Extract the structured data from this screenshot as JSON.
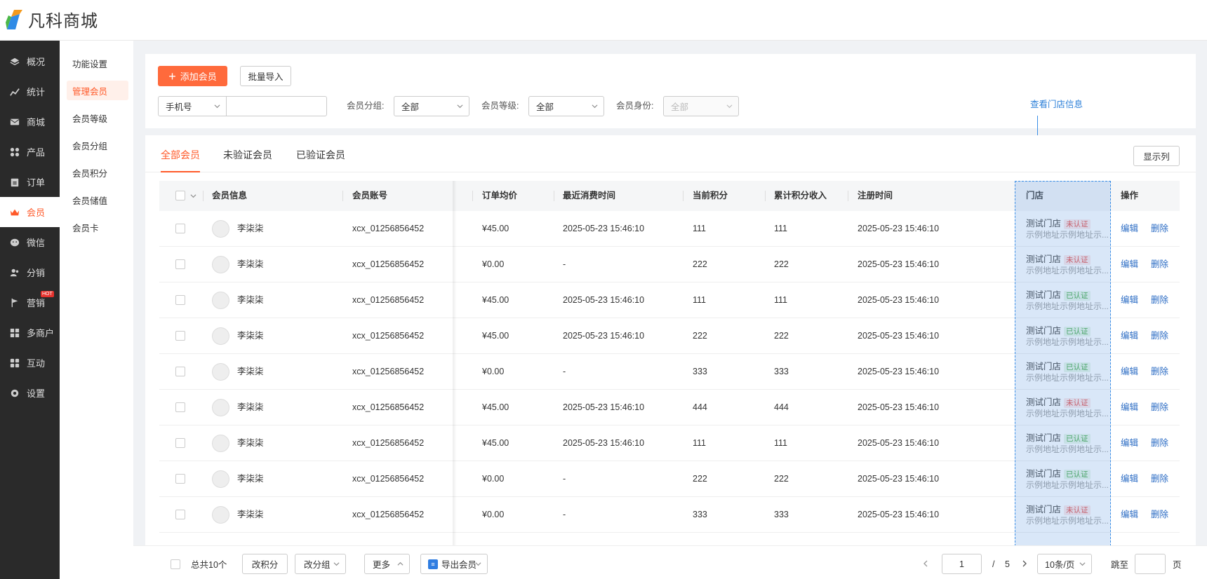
{
  "brand": {
    "name": "凡科商城"
  },
  "nav_main": [
    {
      "label": "概况",
      "icon": "layers-icon"
    },
    {
      "label": "统计",
      "icon": "chart-icon"
    },
    {
      "label": "商城",
      "icon": "mail-icon"
    },
    {
      "label": "产品",
      "icon": "grid-icon"
    },
    {
      "label": "订单",
      "icon": "clipboard-icon"
    },
    {
      "label": "会员",
      "icon": "crown-icon",
      "active": true
    },
    {
      "label": "微信",
      "icon": "wechat-icon"
    },
    {
      "label": "分销",
      "icon": "users-icon"
    },
    {
      "label": "营销",
      "icon": "flag-icon",
      "badge": "HOT"
    },
    {
      "label": "多商户",
      "icon": "store-icon"
    },
    {
      "label": "互动",
      "icon": "apps-icon"
    },
    {
      "label": "设置",
      "icon": "gear-icon"
    }
  ],
  "nav_sub": [
    {
      "label": "功能设置"
    },
    {
      "label": "管理会员",
      "active": true
    },
    {
      "label": "会员等级"
    },
    {
      "label": "会员分组"
    },
    {
      "label": "会员积分"
    },
    {
      "label": "会员储值"
    },
    {
      "label": "会员卡"
    }
  ],
  "toolbar": {
    "add_label": "添加会员",
    "import_label": "批量导入"
  },
  "filters": {
    "search_field": "手机号",
    "search_value": "",
    "group_label": "会员分组:",
    "group_value": "全部",
    "level_label": "会员等级:",
    "level_value": "全部",
    "identity_label": "会员身份:",
    "identity_placeholder": "全部"
  },
  "annotation": {
    "tip": "查看门店信息"
  },
  "tabs": [
    {
      "label": "全部会员",
      "active": true
    },
    {
      "label": "未验证会员"
    },
    {
      "label": "已验证会员"
    }
  ],
  "columns_button": "显示列",
  "table": {
    "headers": {
      "info": "会员信息",
      "account": "会员账号",
      "avg": "订单均价",
      "last": "最近消费时间",
      "points": "当前积分",
      "total": "累计积分收入",
      "reg": "注册时间",
      "store": "门店",
      "ops": "操作"
    },
    "rows": [
      {
        "name": "李柒柒",
        "account": "xcx_01256856452",
        "avg": "¥45.00",
        "last": "2025-05-23 15:46:10",
        "points": "111",
        "total": "111",
        "reg": "2025-05-23 15:46:10",
        "store": "测试门店",
        "status": "未认证",
        "verified": false,
        "addr": "示例地址示例地址示..."
      },
      {
        "name": "李柒柒",
        "account": "xcx_01256856452",
        "avg": "¥0.00",
        "last": "-",
        "points": "222",
        "total": "222",
        "reg": "2025-05-23 15:46:10",
        "store": "测试门店",
        "status": "未认证",
        "verified": false,
        "addr": "示例地址示例地址示..."
      },
      {
        "name": "李柒柒",
        "account": "xcx_01256856452",
        "avg": "¥45.00",
        "last": "2025-05-23 15:46:10",
        "points": "111",
        "total": "111",
        "reg": "2025-05-23 15:46:10",
        "store": "测试门店",
        "status": "已认证",
        "verified": true,
        "addr": "示例地址示例地址示..."
      },
      {
        "name": "李柒柒",
        "account": "xcx_01256856452",
        "avg": "¥45.00",
        "last": "2025-05-23 15:46:10",
        "points": "222",
        "total": "222",
        "reg": "2025-05-23 15:46:10",
        "store": "测试门店",
        "status": "已认证",
        "verified": true,
        "addr": "示例地址示例地址示..."
      },
      {
        "name": "李柒柒",
        "account": "xcx_01256856452",
        "avg": "¥0.00",
        "last": "-",
        "points": "333",
        "total": "333",
        "reg": "2025-05-23 15:46:10",
        "store": "测试门店",
        "status": "已认证",
        "verified": true,
        "addr": "示例地址示例地址示..."
      },
      {
        "name": "李柒柒",
        "account": "xcx_01256856452",
        "avg": "¥45.00",
        "last": "2025-05-23 15:46:10",
        "points": "444",
        "total": "444",
        "reg": "2025-05-23 15:46:10",
        "store": "测试门店",
        "status": "未认证",
        "verified": false,
        "addr": "示例地址示例地址示..."
      },
      {
        "name": "李柒柒",
        "account": "xcx_01256856452",
        "avg": "¥45.00",
        "last": "2025-05-23 15:46:10",
        "points": "111",
        "total": "111",
        "reg": "2025-05-23 15:46:10",
        "store": "测试门店",
        "status": "已认证",
        "verified": true,
        "addr": "示例地址示例地址示..."
      },
      {
        "name": "李柒柒",
        "account": "xcx_01256856452",
        "avg": "¥0.00",
        "last": "-",
        "points": "222",
        "total": "222",
        "reg": "2025-05-23 15:46:10",
        "store": "测试门店",
        "status": "已认证",
        "verified": true,
        "addr": "示例地址示例地址示..."
      },
      {
        "name": "李柒柒",
        "account": "xcx_01256856452",
        "avg": "¥0.00",
        "last": "-",
        "points": "333",
        "total": "333",
        "reg": "2025-05-23 15:46:10",
        "store": "测试门店",
        "status": "未认证",
        "verified": false,
        "addr": "示例地址示例地址示..."
      }
    ],
    "edit_label": "编辑",
    "delete_label": "删除"
  },
  "footer": {
    "total": "总共10个",
    "change_points": "改积分",
    "change_group": "改分组",
    "more": "更多",
    "export": "导出会员",
    "page_current": "1",
    "page_sep": "/",
    "page_total": "5",
    "page_size": "10条/页",
    "jump_label": "跳至",
    "page_unit": "页"
  },
  "colors": {
    "accent": "#ff6a3c",
    "link": "#2b6cc4",
    "sidebar": "#2a2a2a"
  }
}
